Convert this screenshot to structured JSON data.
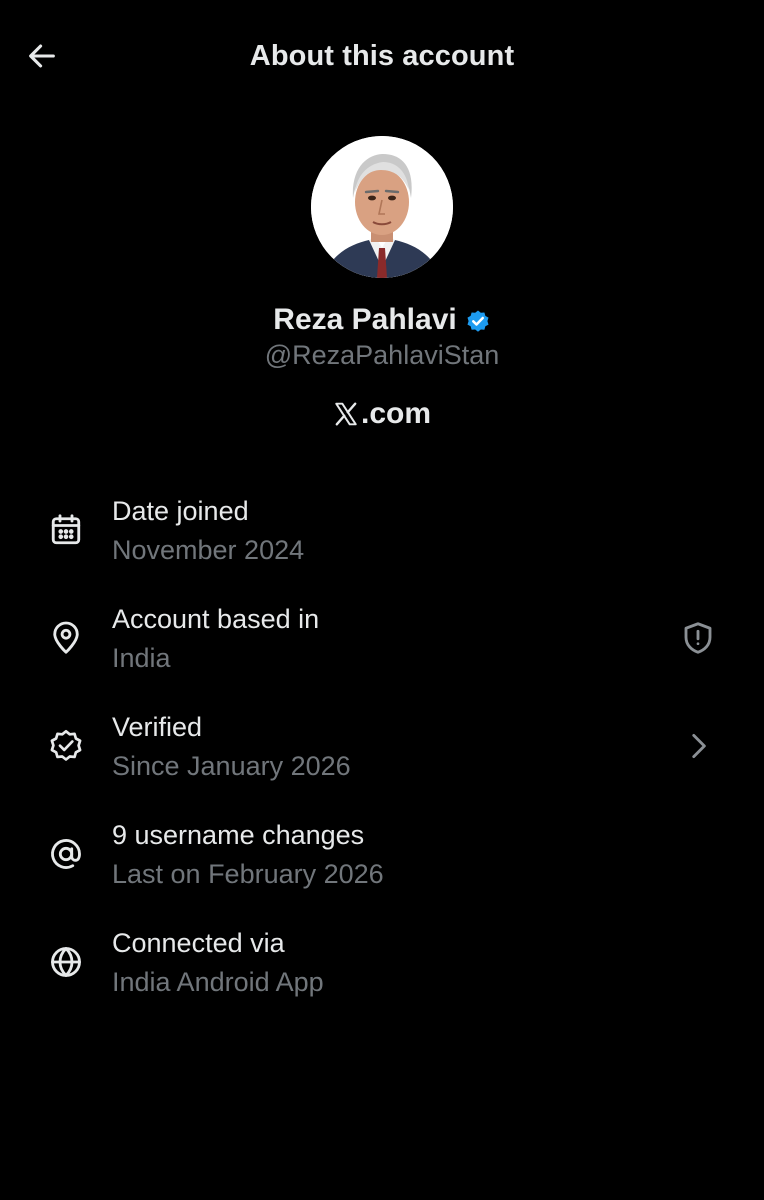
{
  "header": {
    "title": "About this account",
    "back_icon": "arrow-left-icon"
  },
  "profile": {
    "display_name": "Reza Pahlavi",
    "handle": "@RezaPahlaviStan",
    "site": ".com",
    "site_logo": "x-logo-icon",
    "verified_badge": "verified-badge-icon",
    "badge_color": "#1d9bf0"
  },
  "info": [
    {
      "label": "Date joined",
      "value": "November 2024",
      "icon": "calendar-icon"
    },
    {
      "label": "Account based in",
      "value": "India",
      "icon": "location-pin-icon",
      "right_icon": "shield-alert-icon"
    },
    {
      "label": "Verified",
      "value": "Since January 2026",
      "icon": "verified-check-icon",
      "right_icon": "chevron-right-icon"
    },
    {
      "label": "9 username changes",
      "value": "Last on February 2026",
      "icon": "at-sign-icon"
    },
    {
      "label": "Connected via",
      "value": "India Android App",
      "icon": "globe-icon"
    }
  ],
  "colors": {
    "background": "#000000",
    "primary_text": "#e7e9ea",
    "secondary_text": "#71767b",
    "accent": "#1d9bf0"
  }
}
